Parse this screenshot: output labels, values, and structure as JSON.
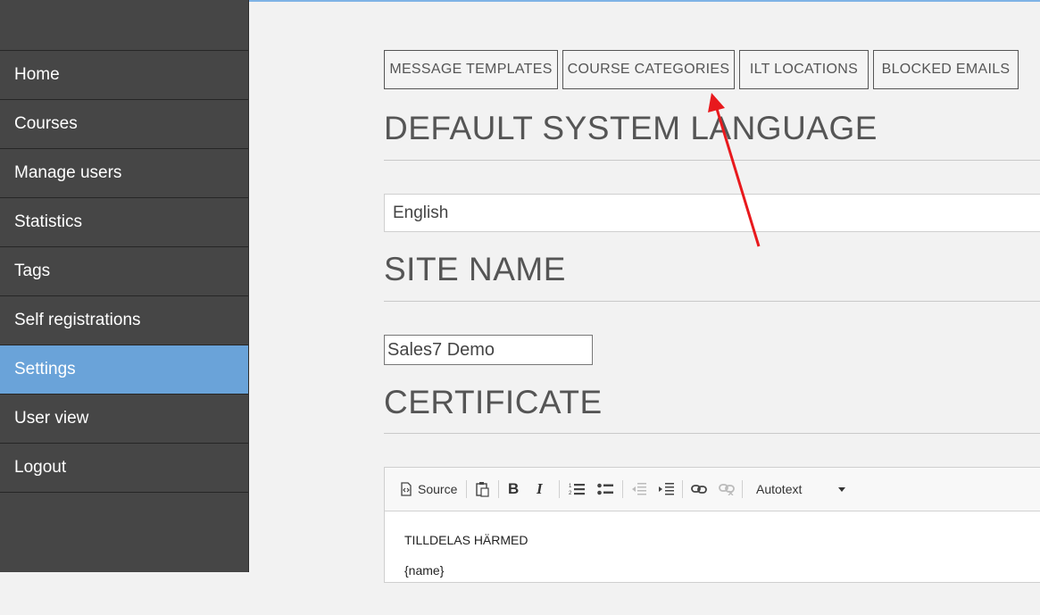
{
  "sidebar": {
    "items": [
      {
        "label": "Home"
      },
      {
        "label": "Courses"
      },
      {
        "label": "Manage users"
      },
      {
        "label": "Statistics"
      },
      {
        "label": "Tags"
      },
      {
        "label": "Self registrations"
      },
      {
        "label": "Settings",
        "active": true
      },
      {
        "label": "User view"
      },
      {
        "label": "Logout"
      }
    ]
  },
  "tabs": [
    {
      "label": "MESSAGE TEMPLATES"
    },
    {
      "label": "COURSE CATEGORIES"
    },
    {
      "label": "ILT LOCATIONS"
    },
    {
      "label": "BLOCKED EMAILS"
    }
  ],
  "sections": {
    "language": {
      "title": "DEFAULT SYSTEM LANGUAGE",
      "value": "English"
    },
    "site_name": {
      "title": "SITE NAME",
      "value": "Sales7 Demo"
    },
    "certificate": {
      "title": "CERTIFICATE"
    }
  },
  "editor": {
    "toolbar": {
      "source_label": "Source",
      "autotext_label": "Autotext"
    },
    "body_lines": [
      "TILLDELAS HÄRMED",
      "{name}"
    ]
  },
  "colors": {
    "sidebar_bg": "#464646",
    "active_item": "#6aa3d9",
    "annotation_arrow": "#e8191d"
  }
}
